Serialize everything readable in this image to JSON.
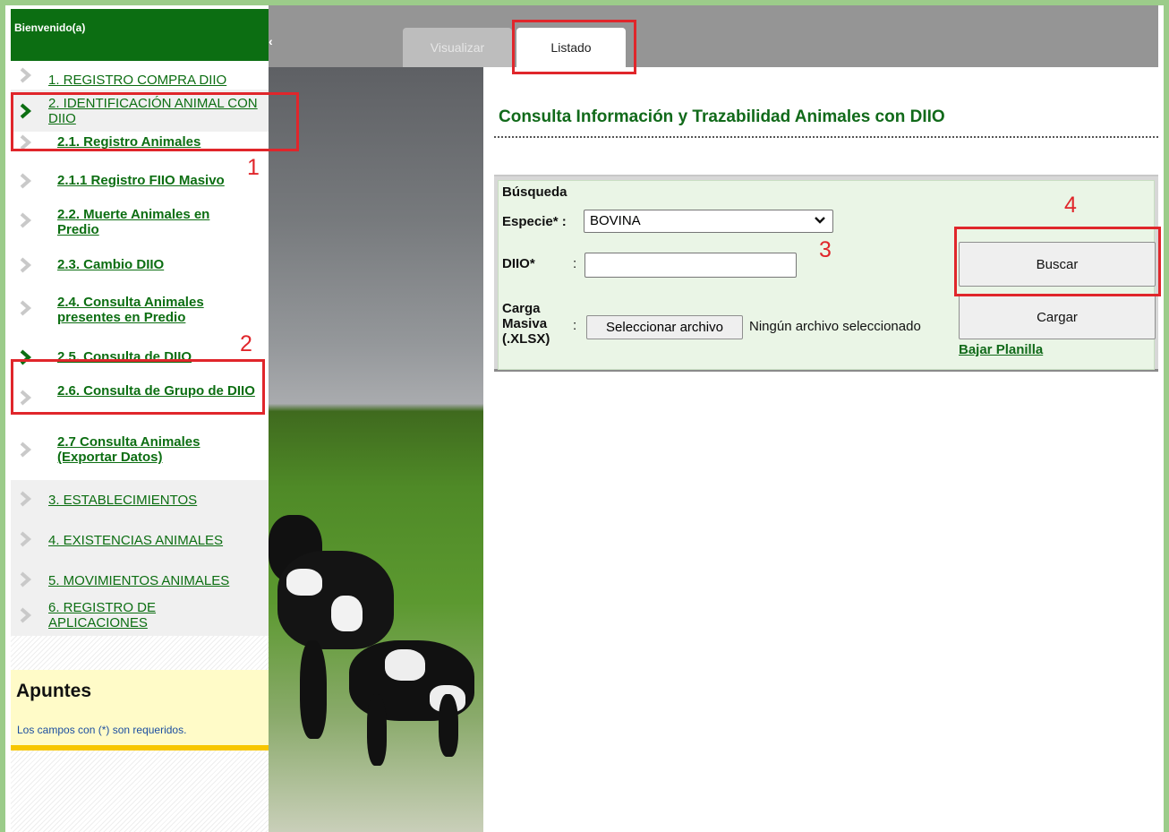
{
  "header": {
    "collapse_glyph": "‹",
    "tabs": [
      {
        "label": "Visualizar",
        "active": false
      },
      {
        "label": "Listado",
        "active": true
      }
    ]
  },
  "sidebar": {
    "welcome": "Bienvenido(a)",
    "items": [
      {
        "label": "1. REGISTRO COMPRA DIIO",
        "level": "top"
      },
      {
        "label": "2. IDENTIFICACIÓN ANIMAL CON DIIO",
        "level": "top",
        "selected": true
      },
      {
        "label": "2.1. Registro Animales",
        "level": "sub"
      },
      {
        "label": "2.1.1 Registro FIIO Masivo",
        "level": "sub"
      },
      {
        "label": "2.2. Muerte Animales en Predio",
        "level": "sub"
      },
      {
        "label": "2.3. Cambio DIIO",
        "level": "sub"
      },
      {
        "label": "2.4. Consulta Animales presentes en Predio",
        "level": "sub"
      },
      {
        "label": "2.5. Consulta de DIIO",
        "level": "sub",
        "selected": true
      },
      {
        "label": "2.6. Consulta de Grupo de DIIO",
        "level": "sub"
      },
      {
        "label": "2.7 Consulta Animales (Exportar Datos)",
        "level": "sub"
      },
      {
        "label": "3. ESTABLECIMIENTOS",
        "level": "top"
      },
      {
        "label": "4. EXISTENCIAS ANIMALES",
        "level": "top"
      },
      {
        "label": "5. MOVIMIENTOS ANIMALES",
        "level": "top"
      },
      {
        "label": "6. REGISTRO DE APLICACIONES",
        "level": "top"
      }
    ],
    "notes": {
      "title": "Apuntes",
      "text": "Los campos con (*) son requeridos."
    }
  },
  "main": {
    "title": "Consulta Información y Trazabilidad Animales con DIIO",
    "search": {
      "section_label": "Búsqueda",
      "species_label": "Especie* :",
      "species_value": "BOVINA",
      "diio_label": "DIIO*",
      "diio_colon": ":",
      "diio_value": "",
      "bulk_label_1": "Carga",
      "bulk_label_2": "Masiva",
      "bulk_label_3": "(.XLSX)",
      "bulk_colon": ":",
      "file_button": "Seleccionar archivo",
      "file_status": "Ningún archivo seleccionado",
      "search_button": "Buscar",
      "upload_button": "Cargar",
      "download_link": "Bajar Planilla"
    }
  },
  "annotations": [
    "1",
    "2",
    "3",
    "4"
  ],
  "colors": {
    "brand_green": "#0c6e12",
    "annotation_red": "#e0262b",
    "frame_green": "#9ccc8a",
    "notes_yellow": "#fffbc8"
  }
}
